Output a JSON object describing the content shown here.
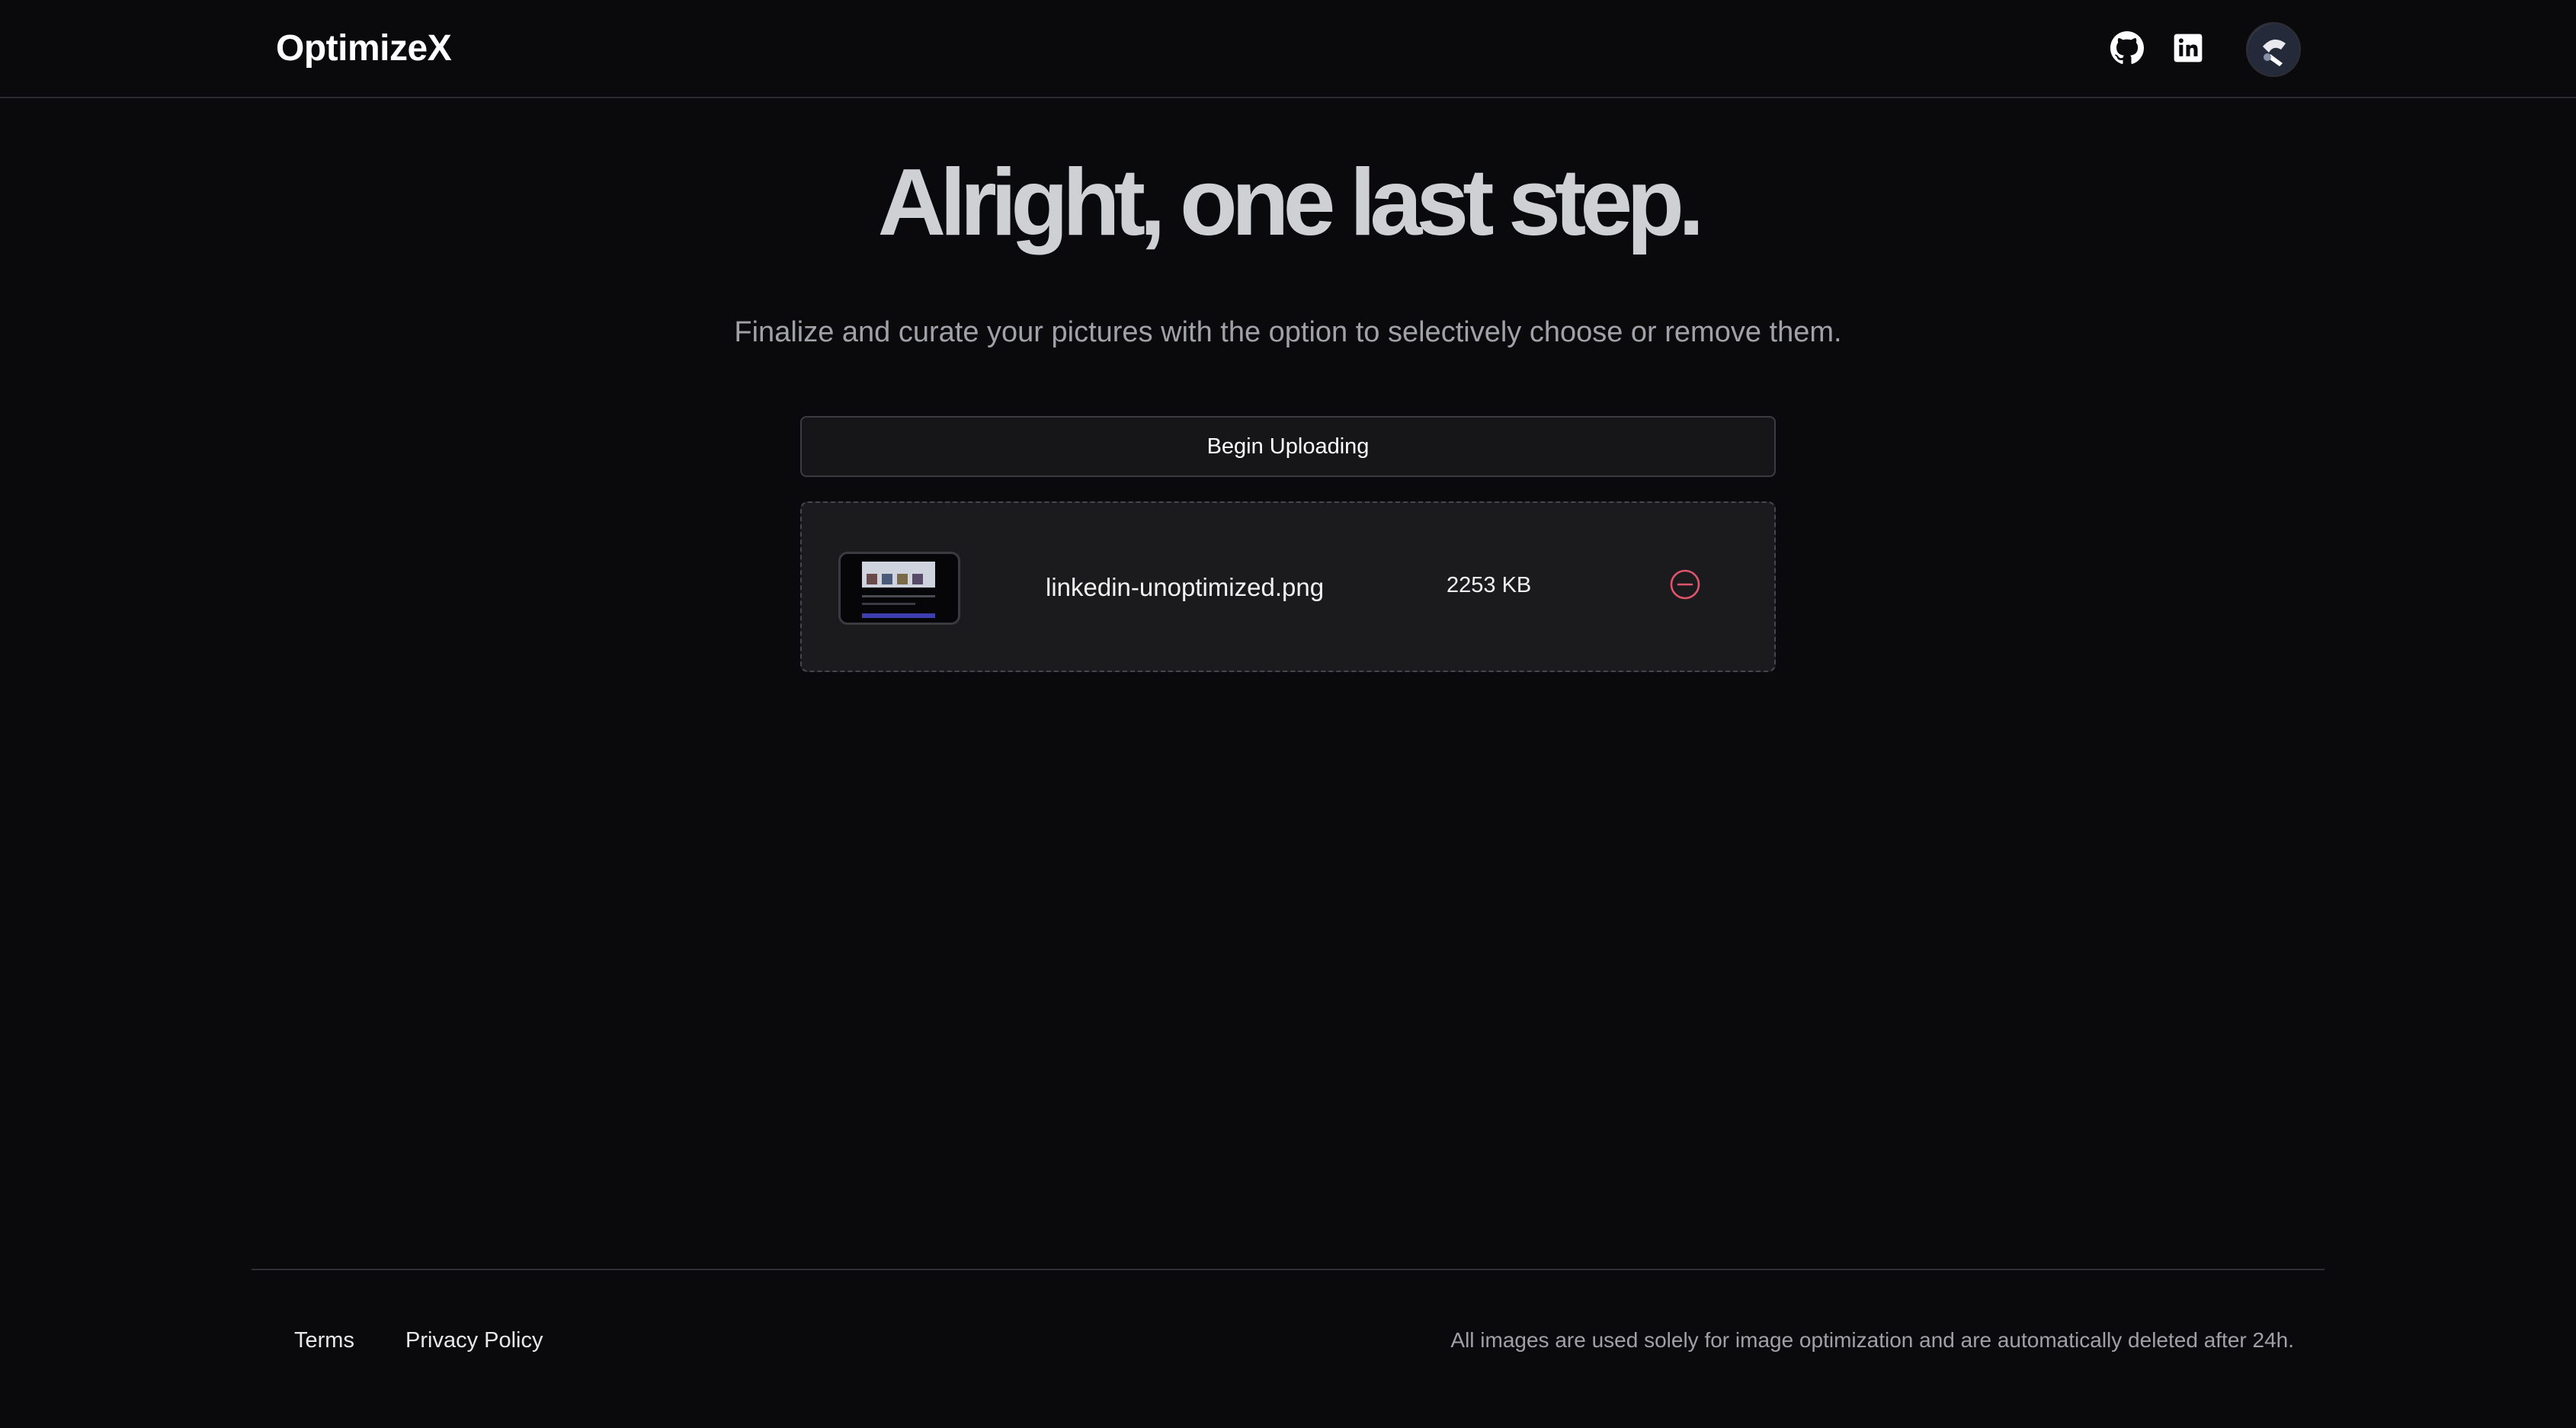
{
  "header": {
    "brand": "OptimizeX",
    "icons": [
      "github-icon",
      "linkedin-icon"
    ]
  },
  "hero": {
    "title": "Alright, one last step.",
    "subtitle": "Finalize and curate your pictures with the option to selectively choose or remove them."
  },
  "upload": {
    "begin_label": "Begin Uploading"
  },
  "files": [
    {
      "name": "linkedin-unoptimized.png",
      "size": "2253 KB"
    }
  ],
  "footer": {
    "terms": "Terms",
    "privacy": "Privacy Policy",
    "note": "All images are used solely for image optimization and are automatically deleted after 24h."
  },
  "colors": {
    "background": "#0a0a0c",
    "card": "#1b1b1e",
    "remove_accent": "#e0556b"
  }
}
